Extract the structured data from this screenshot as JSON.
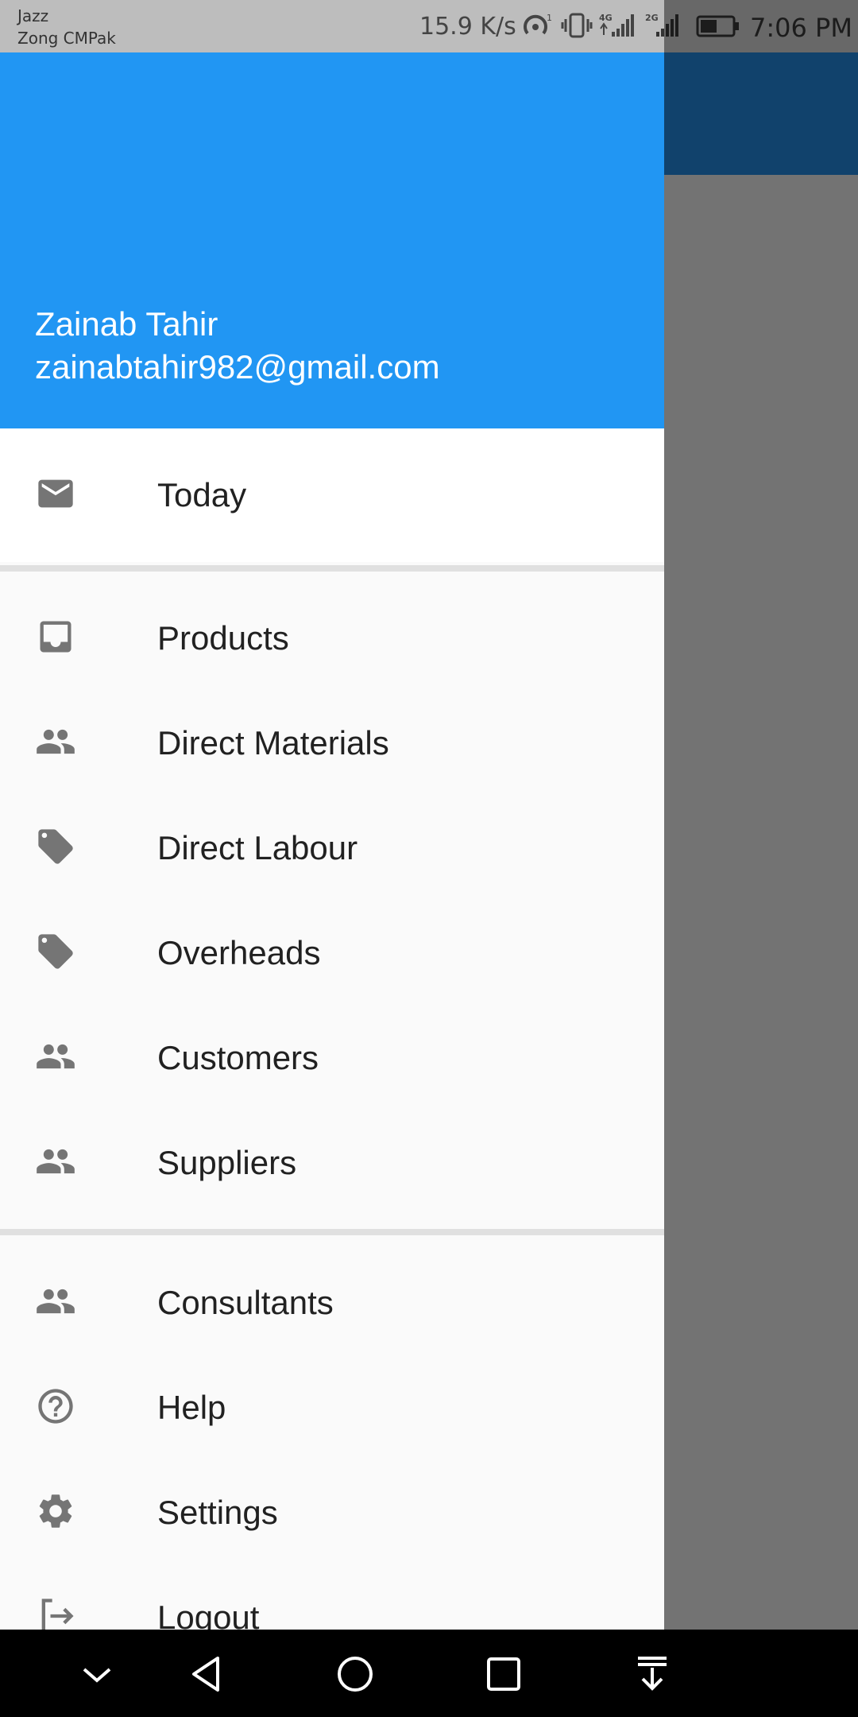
{
  "status_bar": {
    "carrier_1": "Jazz",
    "carrier_2": "Zong CMPak",
    "net_speed": "15.9 K/s",
    "time": "7:06 PM",
    "icons": [
      "hotspot-icon",
      "vibrate-icon",
      "signal-4g-icon",
      "signal-2g-icon",
      "battery-icon"
    ]
  },
  "drawer": {
    "header": {
      "name": "Zainab Tahir",
      "email": "zainabtahir982@gmail.com",
      "background": "#2196f3"
    },
    "today": {
      "label": "Today",
      "icon": "mail-icon"
    },
    "group_1": [
      {
        "label": "Products",
        "icon": "inbox-icon"
      },
      {
        "label": "Direct Materials",
        "icon": "people-icon"
      },
      {
        "label": "Direct Labour",
        "icon": "tag-icon"
      },
      {
        "label": "Overheads",
        "icon": "tag-icon"
      },
      {
        "label": "Customers",
        "icon": "people-icon"
      },
      {
        "label": "Suppliers",
        "icon": "people-icon"
      }
    ],
    "group_2": [
      {
        "label": "Consultants",
        "icon": "people-icon"
      },
      {
        "label": "Help",
        "icon": "help-icon"
      },
      {
        "label": "Settings",
        "icon": "gear-icon"
      },
      {
        "label": "Logout",
        "icon": "logout-icon"
      }
    ]
  },
  "nav_bar": {
    "buttons": [
      "collapse-icon",
      "back-icon",
      "home-icon",
      "recents-icon",
      "notification-pull-icon"
    ]
  }
}
